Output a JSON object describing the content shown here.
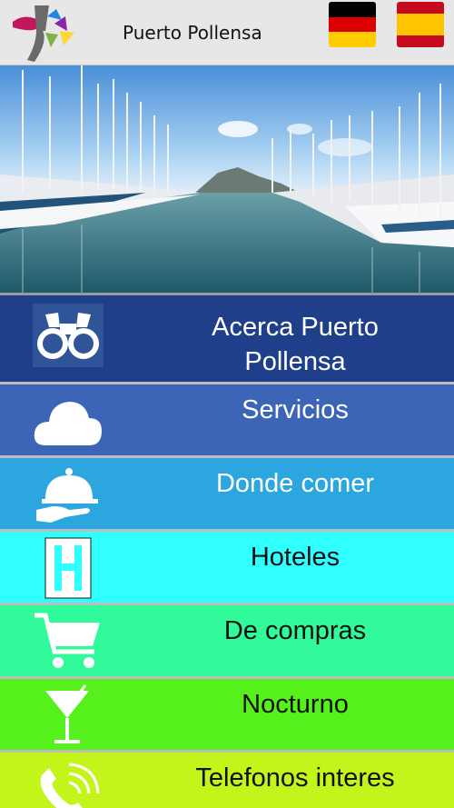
{
  "header": {
    "title": "Puerto Pollensa",
    "flags": [
      {
        "name": "german-flag",
        "colors": [
          "#000000",
          "#dd0000",
          "#ffce00"
        ]
      },
      {
        "name": "spanish-flag",
        "colors": [
          "#c60b1e",
          "#ffc400",
          "#c60b1e"
        ]
      }
    ]
  },
  "hero": {
    "icon": "marina-photo"
  },
  "menu": {
    "items": [
      {
        "label": "Acerca Puerto Pollensa",
        "line1": "Acerca Puerto",
        "line2": "Pollensa",
        "icon": "binoculars-icon",
        "bg": "#1f3f8a",
        "fg": "#ffffff"
      },
      {
        "label": "Servicios",
        "icon": "cloud-icon",
        "bg": "#3c64b7",
        "fg": "#ffffff"
      },
      {
        "label": "Donde comer",
        "icon": "food-tray-icon",
        "bg": "#2ba6de",
        "fg": "#ffffff"
      },
      {
        "label": "Hoteles",
        "icon": "hotel-h-icon",
        "bg": "#2fffff",
        "fg": "#111111"
      },
      {
        "label": "De compras",
        "icon": "shopping-cart-icon",
        "bg": "#31fa9a",
        "fg": "#111111"
      },
      {
        "label": "Nocturno",
        "icon": "cocktail-icon",
        "bg": "#56f01c",
        "fg": "#111111"
      },
      {
        "label": "Telefonos interes",
        "icon": "phone-icon",
        "bg": "#c4f51a",
        "fg": "#111111"
      }
    ]
  }
}
